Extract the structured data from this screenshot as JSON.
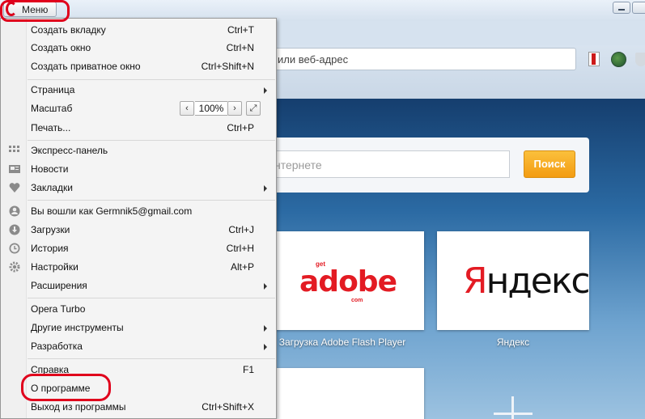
{
  "window": {
    "menu_button_label": "Меню"
  },
  "address_bar": {
    "text": "или веб-адрес"
  },
  "search": {
    "placeholder": "нтернете",
    "button_label": "Поиск"
  },
  "speed_dial": [
    {
      "caption": "Загрузка Adobe Flash Player",
      "logo_prefix": "get",
      "logo_text": "adobe",
      "logo_suffix": "com"
    },
    {
      "caption": "Яндекс",
      "logo_first_letter": "Я",
      "logo_rest": "ндекс"
    }
  ],
  "menu": {
    "items": [
      {
        "label": "Создать вкладку",
        "shortcut": "Ctrl+T"
      },
      {
        "label": "Создать окно",
        "shortcut": "Ctrl+N"
      },
      {
        "label": "Создать приватное окно",
        "shortcut": "Ctrl+Shift+N"
      },
      {
        "label": "Страница",
        "shortcut": ""
      },
      {
        "label": "Масштаб",
        "shortcut": ""
      },
      {
        "label": "Печать...",
        "shortcut": "Ctrl+P"
      },
      {
        "label": "Экспресс-панель",
        "shortcut": ""
      },
      {
        "label": "Новости",
        "shortcut": ""
      },
      {
        "label": "Закладки",
        "shortcut": ""
      },
      {
        "label": "Вы вошли как Germnik5@gmail.com",
        "shortcut": ""
      },
      {
        "label": "Загрузки",
        "shortcut": "Ctrl+J"
      },
      {
        "label": "История",
        "shortcut": "Ctrl+H"
      },
      {
        "label": "Настройки",
        "shortcut": "Alt+P"
      },
      {
        "label": "Расширения",
        "shortcut": ""
      },
      {
        "label": "Opera Turbo",
        "shortcut": ""
      },
      {
        "label": "Другие инструменты",
        "shortcut": ""
      },
      {
        "label": "Разработка",
        "shortcut": ""
      },
      {
        "label": "Справка",
        "shortcut": "F1"
      },
      {
        "label": "О программе",
        "shortcut": ""
      },
      {
        "label": "Выход из программы",
        "shortcut": "Ctrl+Shift+X"
      }
    ],
    "zoom": {
      "value": "100%",
      "minus": "‹",
      "plus": "›",
      "fit": "⤢"
    }
  },
  "colors": {
    "accent": "#e0001c",
    "search_button": "#f39c12",
    "brand_red": "#e31b23"
  },
  "icons": {
    "speed_dial": "grid-icon",
    "news": "news-icon",
    "bookmarks": "heart-icon",
    "account": "user-icon",
    "downloads": "download-icon",
    "history": "clock-icon",
    "settings": "gear-icon"
  }
}
